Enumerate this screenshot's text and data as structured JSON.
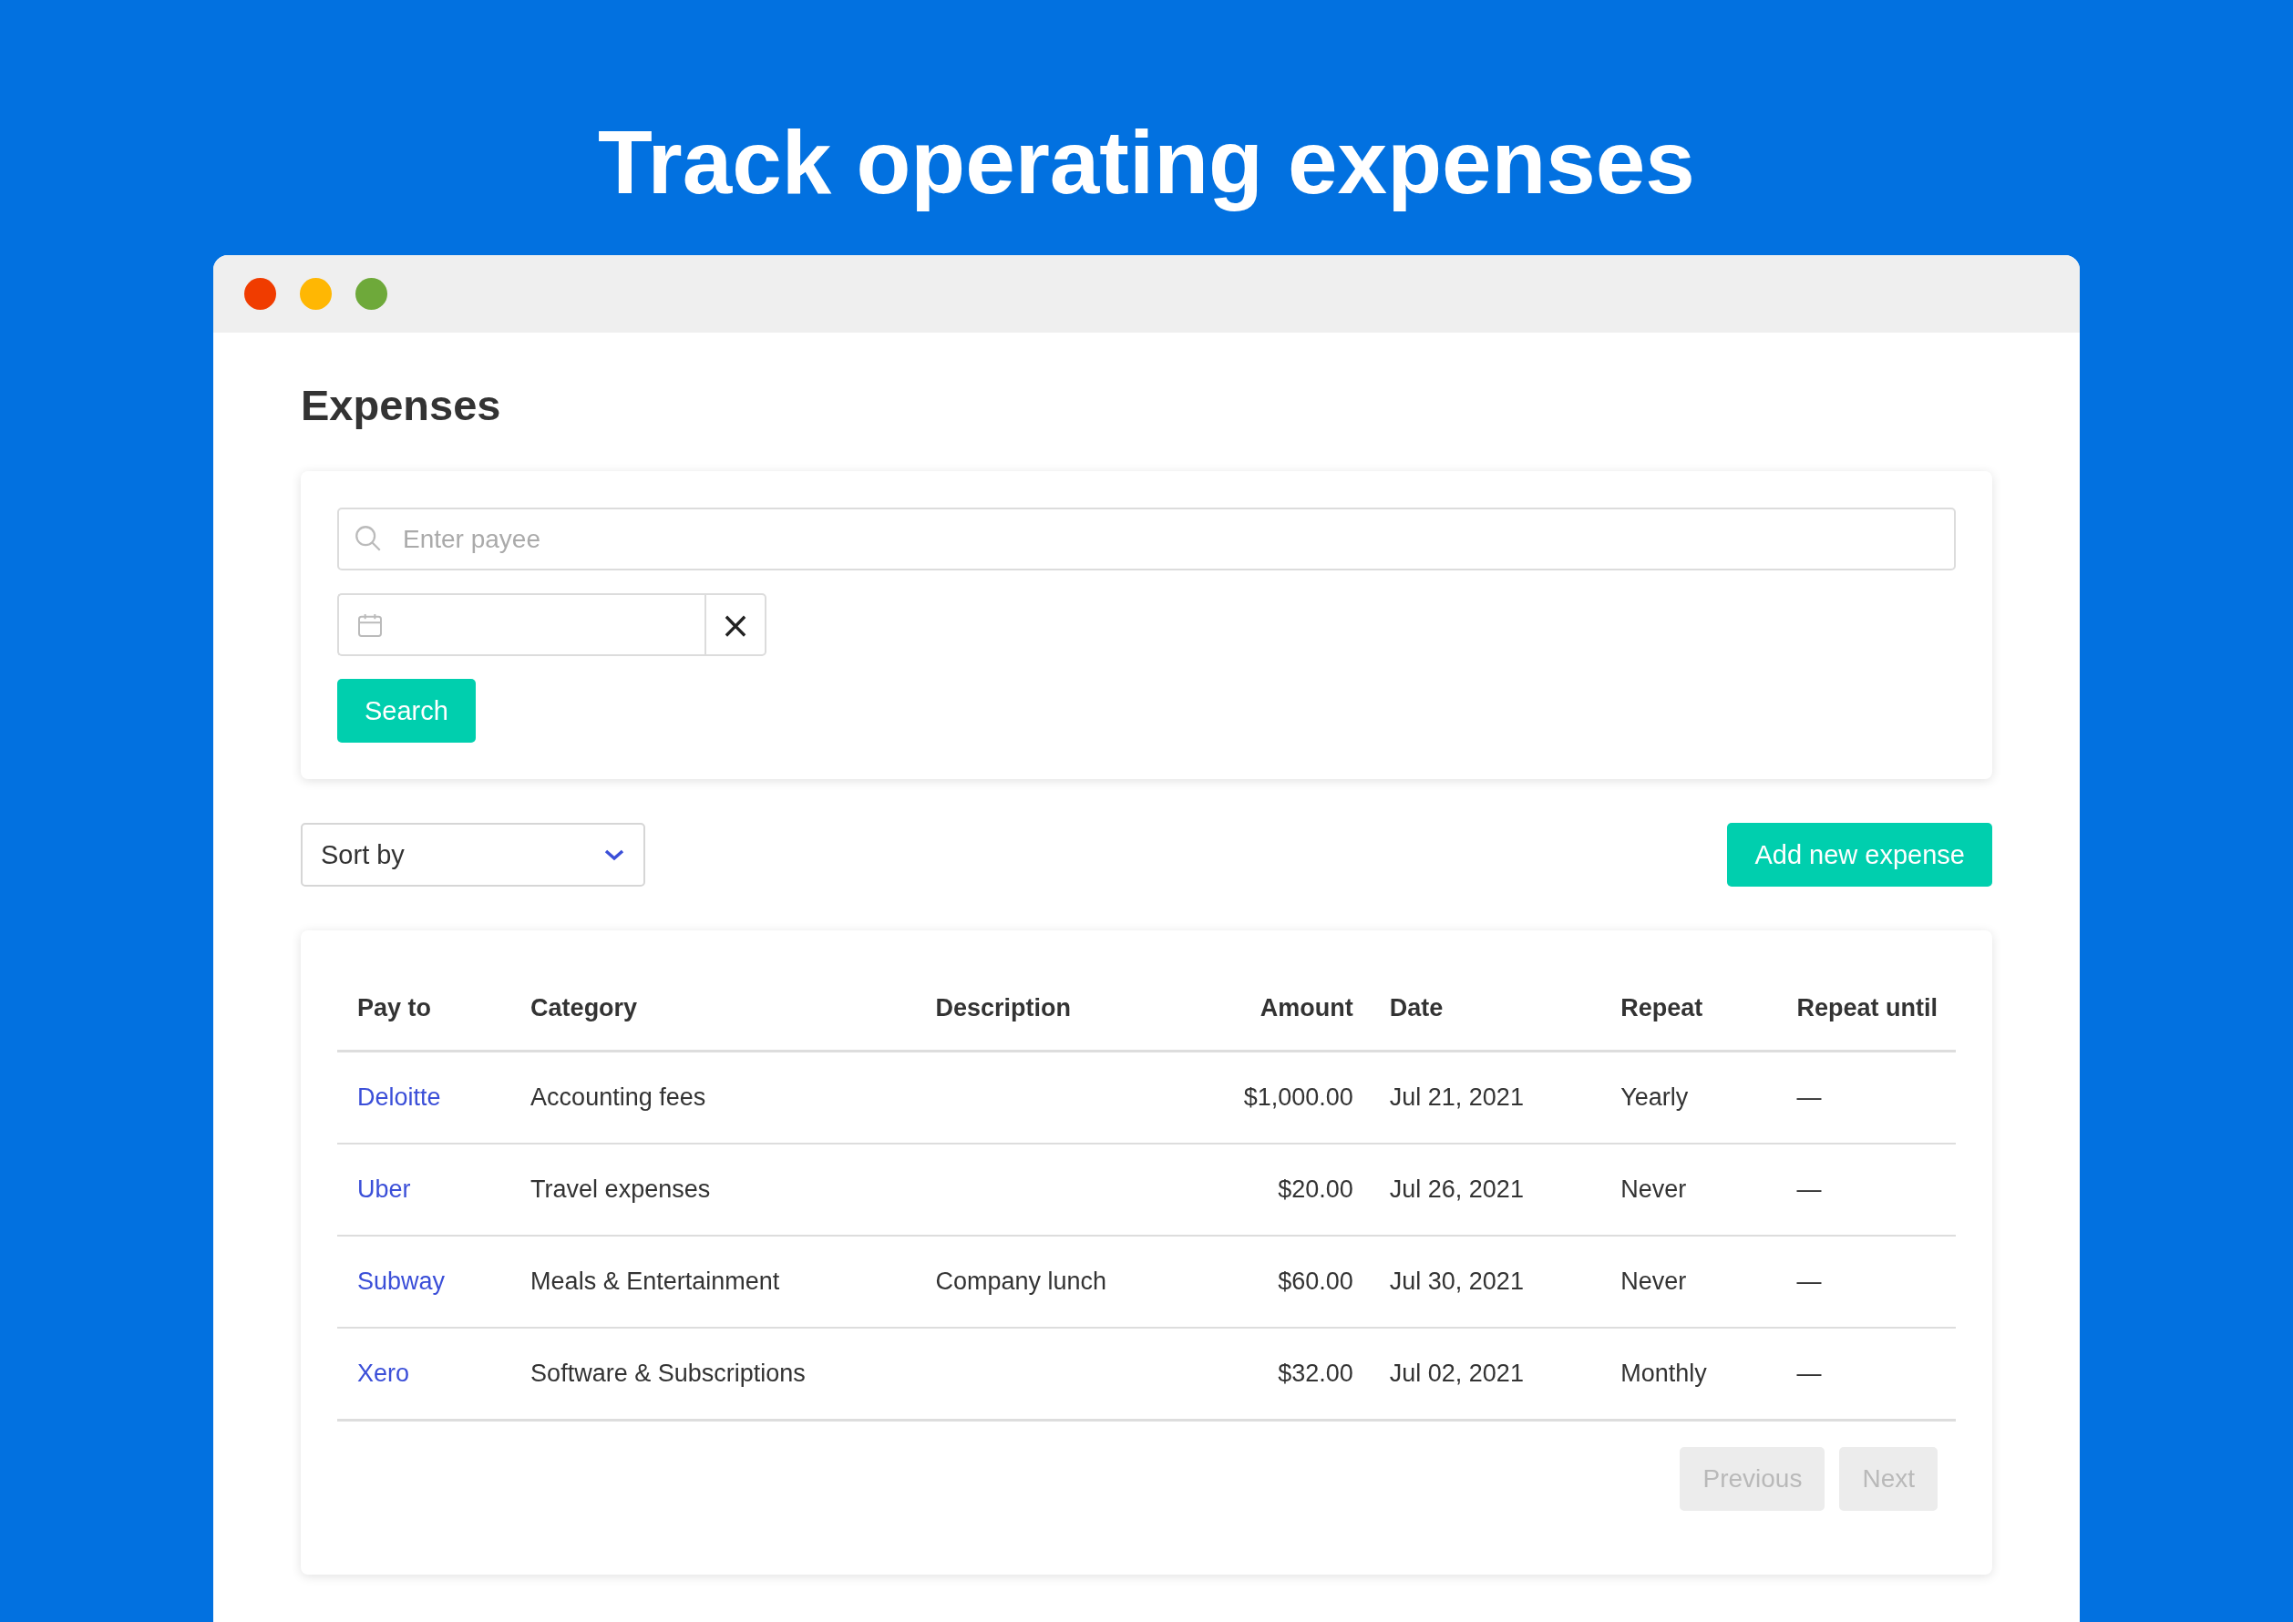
{
  "headline": "Track operating expenses",
  "page": {
    "title": "Expenses"
  },
  "filters": {
    "payee_search": {
      "placeholder": "Enter payee"
    },
    "clear_date": "×",
    "search_button": "Search"
  },
  "sort": {
    "label": "Sort by"
  },
  "add_button": "Add new expense",
  "table": {
    "columns": [
      "Pay to",
      "Category",
      "Description",
      "Amount",
      "Date",
      "Repeat",
      "Repeat until"
    ],
    "rows": [
      {
        "cells": [
          "Deloitte",
          "Accounting fees",
          "",
          "$1,000.00",
          "Jul 21, 2021",
          "Yearly",
          "—"
        ]
      },
      {
        "cells": [
          "Uber",
          "Travel expenses",
          "",
          "$20.00",
          "Jul 26, 2021",
          "Never",
          "—"
        ]
      },
      {
        "cells": [
          "Subway",
          "Meals & Entertainment",
          "Company lunch",
          "$60.00",
          "Jul 30, 2021",
          "Never",
          "—"
        ]
      },
      {
        "cells": [
          "Xero",
          "Software & Subscriptions",
          "",
          "$32.00",
          "Jul 02, 2021",
          "Monthly",
          "—"
        ]
      }
    ]
  },
  "pagination": [
    {
      "label": "Previous",
      "disabled": true
    },
    {
      "label": "Next",
      "disabled": true
    }
  ]
}
